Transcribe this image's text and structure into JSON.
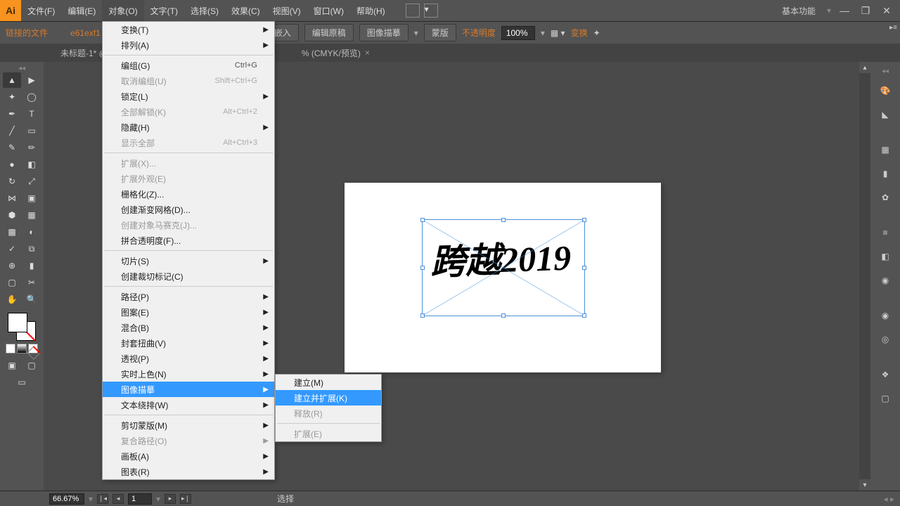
{
  "menubar": {
    "items": [
      "文件(F)",
      "编辑(E)",
      "对象(O)",
      "文字(T)",
      "选择(S)",
      "效果(C)",
      "视图(V)",
      "窗口(W)",
      "帮助(H)"
    ],
    "active_index": 2,
    "workspace": "基本功能"
  },
  "controlbar": {
    "linked_file": "链接的文件",
    "filename": "e61exf1",
    "embed": "嵌入",
    "edit_original": "编辑原稿",
    "image_trace": "图像描摹",
    "mask": "蒙版",
    "opacity_label": "不透明度",
    "opacity_value": "100%",
    "transform": "变换"
  },
  "document": {
    "tab_left": "未标题-1* @",
    "tab_main": "% (CMYK/预览)",
    "artboard_text": "跨越2019"
  },
  "status": {
    "zoom": "66.67%",
    "page": "1",
    "tool": "选择"
  },
  "dropdown_main": [
    {
      "label": "变换(T)",
      "arrow": true
    },
    {
      "label": "排列(A)",
      "arrow": true
    },
    {
      "sep": true
    },
    {
      "label": "编组(G)",
      "shortcut": "Ctrl+G"
    },
    {
      "label": "取消编组(U)",
      "shortcut": "Shift+Ctrl+G",
      "disabled": true
    },
    {
      "label": "锁定(L)",
      "arrow": true
    },
    {
      "label": "全部解锁(K)",
      "shortcut": "Alt+Ctrl+2",
      "disabled": true
    },
    {
      "label": "隐藏(H)",
      "arrow": true
    },
    {
      "label": "显示全部",
      "shortcut": "Alt+Ctrl+3",
      "disabled": true
    },
    {
      "sep": true
    },
    {
      "label": "扩展(X)...",
      "disabled": true
    },
    {
      "label": "扩展外观(E)",
      "disabled": true
    },
    {
      "label": "栅格化(Z)..."
    },
    {
      "label": "创建渐变网格(D)..."
    },
    {
      "label": "创建对象马赛克(J)...",
      "disabled": true
    },
    {
      "label": "拼合透明度(F)..."
    },
    {
      "sep": true
    },
    {
      "label": "切片(S)",
      "arrow": true
    },
    {
      "label": "创建裁切标记(C)"
    },
    {
      "sep": true
    },
    {
      "label": "路径(P)",
      "arrow": true
    },
    {
      "label": "图案(E)",
      "arrow": true
    },
    {
      "label": "混合(B)",
      "arrow": true
    },
    {
      "label": "封套扭曲(V)",
      "arrow": true
    },
    {
      "label": "透视(P)",
      "arrow": true
    },
    {
      "label": "实时上色(N)",
      "arrow": true
    },
    {
      "label": "图像描摹",
      "arrow": true,
      "hl": true
    },
    {
      "label": "文本绕排(W)",
      "arrow": true
    },
    {
      "sep": true
    },
    {
      "label": "剪切蒙版(M)",
      "arrow": true
    },
    {
      "label": "复合路径(O)",
      "arrow": true,
      "disabled": true
    },
    {
      "label": "画板(A)",
      "arrow": true
    },
    {
      "label": "图表(R)",
      "arrow": true
    }
  ],
  "dropdown_sub": [
    {
      "label": "建立(M)"
    },
    {
      "label": "建立并扩展(K)",
      "hl": true
    },
    {
      "label": "释放(R)",
      "disabled": true
    },
    {
      "sep": true
    },
    {
      "label": "扩展(E)",
      "disabled": true
    }
  ]
}
